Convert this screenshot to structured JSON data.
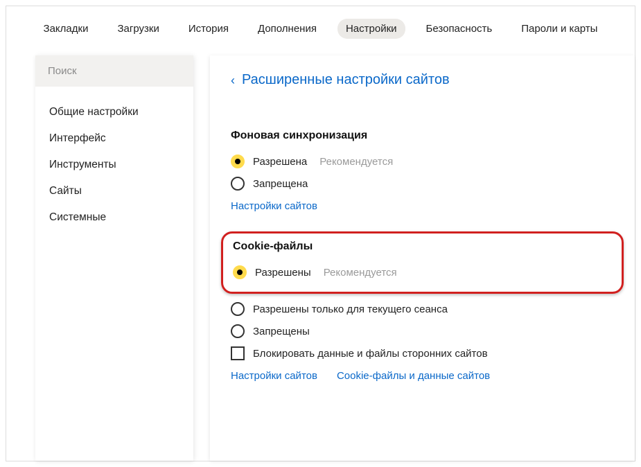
{
  "nav": {
    "items": [
      {
        "label": "Закладки",
        "active": false
      },
      {
        "label": "Загрузки",
        "active": false
      },
      {
        "label": "История",
        "active": false
      },
      {
        "label": "Дополнения",
        "active": false
      },
      {
        "label": "Настройки",
        "active": true
      },
      {
        "label": "Безопасность",
        "active": false
      },
      {
        "label": "Пароли и карты",
        "active": false
      }
    ]
  },
  "sidebar": {
    "search_placeholder": "Поиск",
    "items": [
      {
        "label": "Общие настройки"
      },
      {
        "label": "Интерфейс"
      },
      {
        "label": "Инструменты"
      },
      {
        "label": "Сайты"
      },
      {
        "label": "Системные"
      }
    ]
  },
  "content": {
    "back_label": "Расширенные настройки сайтов",
    "sections": {
      "bgsync": {
        "title": "Фоновая синхронизация",
        "opt_allowed": "Разрешена",
        "opt_allowed_hint": "Рекомендуется",
        "opt_blocked": "Запрещена",
        "link_sites": "Настройки сайтов"
      },
      "cookies": {
        "title": "Cookie-файлы",
        "opt_allowed": "Разрешены",
        "opt_allowed_hint": "Рекомендуется",
        "opt_session": "Разрешены только для текущего сеанса",
        "opt_blocked": "Запрещены",
        "opt_block3p": "Блокировать данные и файлы сторонних сайтов",
        "link_sites": "Настройки сайтов",
        "link_data": "Cookie-файлы и данные сайтов"
      }
    }
  }
}
